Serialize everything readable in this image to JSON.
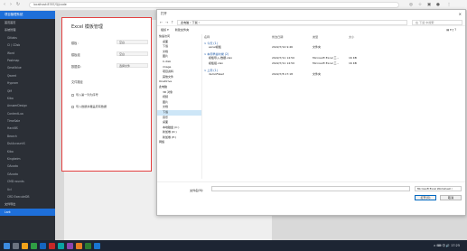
{
  "browser": {
    "address": "localhost:8787/Qj/code",
    "back_icon": "arrow-left-icon",
    "forward_icon": "arrow-right-icon",
    "refresh_icon": "refresh-icon"
  },
  "sidebar": {
    "brand": "项目管理系统",
    "items": [
      {
        "label": "首页首页"
      },
      {
        "label": "系统管理"
      },
      {
        "label": "Gitlabs"
      },
      {
        "label": "CI / CDsb"
      },
      {
        "label": "Word"
      },
      {
        "label": "Postmap"
      },
      {
        "label": "Gmailblue"
      },
      {
        "label": "Qweet"
      },
      {
        "label": "Hyprom"
      },
      {
        "label": "QM"
      },
      {
        "label": "Kibo"
      },
      {
        "label": "AnswerDesign"
      },
      {
        "label": "ContentLua"
      },
      {
        "label": "TimeSale"
      },
      {
        "label": "HackBS"
      },
      {
        "label": "Bearch"
      },
      {
        "label": "DulAccountS"
      },
      {
        "label": "Kibo"
      },
      {
        "label": "Kingbeim"
      },
      {
        "label": "OAcoda"
      },
      {
        "label": "OAcoda"
      },
      {
        "label": "CMD rounds"
      },
      {
        "label": "Ucl"
      },
      {
        "label": "CRD ExecuteDB"
      },
      {
        "label": "文件导出"
      },
      {
        "label": "Lark"
      }
    ]
  },
  "form": {
    "title": "Excel 模板管理",
    "field1_label": "模板：",
    "field1_value": "空白",
    "field2_label": "模板组",
    "field2_value": "空白",
    "field3_label": "数据源：",
    "field3_value": "选择文件",
    "field4_label": "文件路径",
    "check1": "导入第一列为序号",
    "check2": "导入数据并覆盖原有数据",
    "outside_ctrl1": "模版",
    "outside_ctrl2": "选择导入"
  },
  "dialog": {
    "title": "打开",
    "close": "×",
    "path": "此电脑  ›  下载  ›",
    "search_placeholder": "在 下载 中搜索",
    "toolbar": [
      "组织 ▾",
      "新建文件夹"
    ],
    "view": "▤ ▾  ▯  ?",
    "tree": [
      {
        "label": "快速访问",
        "top": true
      },
      {
        "label": "桌面"
      },
      {
        "label": "下载"
      },
      {
        "label": "文档"
      },
      {
        "label": "图片"
      },
      {
        "label": "C-disk"
      },
      {
        "label": "image"
      },
      {
        "label": "项目资料"
      },
      {
        "label": "其他文件"
      },
      {
        "label": "OneDrive",
        "top": true
      },
      {
        "label": "此电脑",
        "top": true
      },
      {
        "label": "3D 对象"
      },
      {
        "label": "视频"
      },
      {
        "label": "图片"
      },
      {
        "label": "文档"
      },
      {
        "label": "下载",
        "selected": true
      },
      {
        "label": "音乐"
      },
      {
        "label": "桌面"
      },
      {
        "label": "本地磁盘 (C:)"
      },
      {
        "label": "新加卷 (D:)"
      },
      {
        "label": "新加卷 (E:)"
      },
      {
        "label": "网络",
        "top": true
      }
    ],
    "columns": [
      "名称",
      "修改日期",
      "类型",
      "大小"
    ],
    "groups": [
      {
        "label": "∨ 今天 (1)"
      },
      {
        "label": "∨ 本周早些时候 (2)"
      },
      {
        "label": "∨ 上周 (1)"
      }
    ],
    "files": [
      {
        "name": "excel模板",
        "date": "2022/7/14 9:46",
        "type": "文件夹",
        "size": ""
      },
      {
        "name": "模板导入-数据.xlsx",
        "date": "2022/7/11 14:50",
        "type": "Microsoft Excel 工...",
        "size": "16 KB"
      },
      {
        "name": "模板组.xlsx",
        "date": "2022/7/11 14:50",
        "type": "Microsoft Excel 工...",
        "size": "16 KB"
      },
      {
        "name": "demoFiles2",
        "date": "2022/7/8 17:18",
        "type": "文件夹",
        "size": ""
      }
    ],
    "filename_label": "文件名(N):",
    "filetype": "Microsoft Excel Worksheet (",
    "open_btn": "打开(O)",
    "cancel_btn": "取消"
  },
  "taskbar": {
    "tray": "∧  ⌨  中  🔊  17:25"
  },
  "colors": {
    "sidebar_bg": "#2b2f36",
    "accent": "#1e6fd9",
    "highlight_border": "#e34040",
    "taskbar_bg": "#1d2533"
  }
}
